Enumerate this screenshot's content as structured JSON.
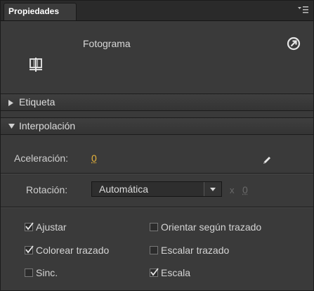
{
  "panel": {
    "tab_label": "Propiedades",
    "frame_label": "Fotograma"
  },
  "sections": {
    "label_section": "Etiqueta",
    "tween_section": "Interpolación"
  },
  "tween": {
    "easing_label": "Aceleración:",
    "easing_value": "0",
    "rotation_label": "Rotación:",
    "rotation_selected": "Automática",
    "rotation_times_symbol": "x",
    "rotation_count": "0"
  },
  "options": [
    {
      "label": "Ajustar",
      "checked": true
    },
    {
      "label": "Orientar según trazado",
      "checked": false
    },
    {
      "label": "Colorear trazado",
      "checked": true
    },
    {
      "label": "Escalar trazado",
      "checked": false
    },
    {
      "label": "Sinc.",
      "checked": false
    },
    {
      "label": "Escala",
      "checked": true
    }
  ],
  "colors": {
    "panel_bg": "#3a3a3a",
    "hot_value": "#e8b43a"
  }
}
